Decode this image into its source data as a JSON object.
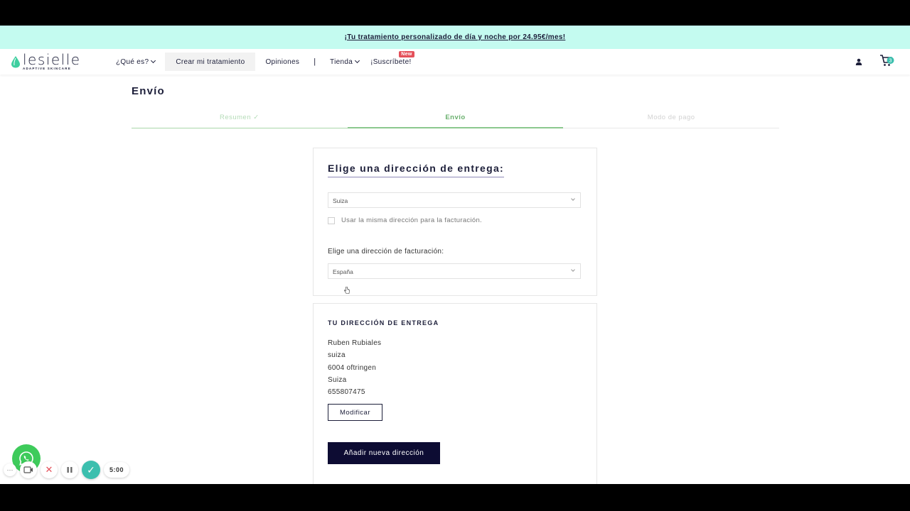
{
  "promo": {
    "text": "¡Tu tratamiento personalizado de día y noche por 24.95€/mes!"
  },
  "logo": {
    "word": "lesielle",
    "tagline": "ADAPTIVE SKINCARE"
  },
  "nav": {
    "que_es": "¿Qué es?",
    "crear": "Crear mi tratamiento",
    "opiniones": "Opiniones",
    "separator": "|",
    "tienda": "Tienda",
    "suscribete": "¡Suscríbete!",
    "new_badge": "New"
  },
  "cart": {
    "count": "3"
  },
  "page": {
    "title": "Envío"
  },
  "steps": [
    {
      "label": "Resumen ✓",
      "state": "done"
    },
    {
      "label": "Envío",
      "state": "current"
    },
    {
      "label": "Modo de pago",
      "state": "pending"
    }
  ],
  "delivery_form": {
    "heading": "Elige una dirección de entrega:",
    "delivery_select": "Suiza",
    "same_billing_label": "Usar la misma dirección para la facturación.",
    "same_billing_checked": false,
    "billing_label": "Elige una dirección de facturación:",
    "billing_select": "España"
  },
  "address": {
    "heading": "TU DIRECCIÓN DE ENTREGA",
    "lines": [
      "Ruben Rubiales",
      "suiza",
      "6004 oftringen",
      "Suiza",
      "655807475"
    ],
    "modify_label": "Modificar",
    "add_label": "Añadir nueva dirección"
  },
  "recorder": {
    "time": "5:00"
  },
  "colors": {
    "promo_bg": "#c4fbf0",
    "brand_navy": "#0d0c33",
    "step_active": "#6ab06e",
    "accent_teal": "#3cbfae",
    "whatsapp": "#3ecb5b"
  }
}
